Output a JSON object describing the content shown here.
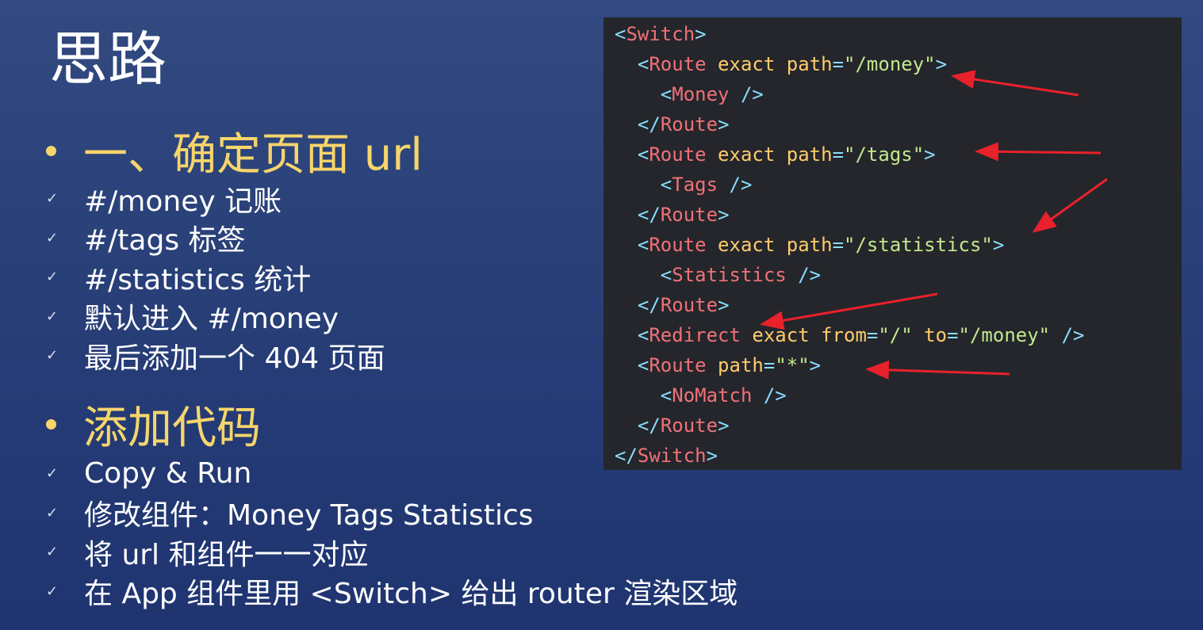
{
  "slide": {
    "title": "思路"
  },
  "sections": [
    {
      "heading": "一、确定页面 url",
      "items": [
        "#/money 记账",
        "#/tags 标签",
        "#/statistics 统计",
        "默认进入 #/money",
        "最后添加一个 404 页面"
      ]
    },
    {
      "heading": "添加代码",
      "items": [
        "Copy & Run",
        "修改组件：Money Tags Statistics",
        "将 url 和组件一一对应",
        "在 App 组件里用 <Switch> 给出 router 渲染区域"
      ]
    }
  ],
  "code": {
    "lines": [
      [
        {
          "t": "<",
          "c": "punct"
        },
        {
          "t": "Switch",
          "c": "tag"
        },
        {
          "t": ">",
          "c": "punct"
        }
      ],
      [
        {
          "t": "  "
        },
        {
          "t": "<",
          "c": "punct"
        },
        {
          "t": "Route",
          "c": "tag"
        },
        {
          "t": " exact path",
          "c": "attr"
        },
        {
          "t": "=",
          "c": "op"
        },
        {
          "t": "\"/money\"",
          "c": "str"
        },
        {
          "t": ">",
          "c": "punct"
        }
      ],
      [
        {
          "t": "    "
        },
        {
          "t": "<",
          "c": "punct"
        },
        {
          "t": "Money",
          "c": "tag"
        },
        {
          "t": " />",
          "c": "punct"
        }
      ],
      [
        {
          "t": "  "
        },
        {
          "t": "</",
          "c": "punct"
        },
        {
          "t": "Route",
          "c": "tag"
        },
        {
          "t": ">",
          "c": "punct"
        }
      ],
      [
        {
          "t": "  "
        },
        {
          "t": "<",
          "c": "punct"
        },
        {
          "t": "Route",
          "c": "tag"
        },
        {
          "t": " exact path",
          "c": "attr"
        },
        {
          "t": "=",
          "c": "op"
        },
        {
          "t": "\"/tags\"",
          "c": "str"
        },
        {
          "t": ">",
          "c": "punct"
        }
      ],
      [
        {
          "t": "    "
        },
        {
          "t": "<",
          "c": "punct"
        },
        {
          "t": "Tags",
          "c": "tag"
        },
        {
          "t": " />",
          "c": "punct"
        }
      ],
      [
        {
          "t": "  "
        },
        {
          "t": "</",
          "c": "punct"
        },
        {
          "t": "Route",
          "c": "tag"
        },
        {
          "t": ">",
          "c": "punct"
        }
      ],
      [
        {
          "t": "  "
        },
        {
          "t": "<",
          "c": "punct"
        },
        {
          "t": "Route",
          "c": "tag"
        },
        {
          "t": " exact path",
          "c": "attr"
        },
        {
          "t": "=",
          "c": "op"
        },
        {
          "t": "\"/statistics\"",
          "c": "str"
        },
        {
          "t": ">",
          "c": "punct"
        }
      ],
      [
        {
          "t": "    "
        },
        {
          "t": "<",
          "c": "punct"
        },
        {
          "t": "Statistics",
          "c": "tag"
        },
        {
          "t": " />",
          "c": "punct"
        }
      ],
      [
        {
          "t": "  "
        },
        {
          "t": "</",
          "c": "punct"
        },
        {
          "t": "Route",
          "c": "tag"
        },
        {
          "t": ">",
          "c": "punct"
        }
      ],
      [
        {
          "t": "  "
        },
        {
          "t": "<",
          "c": "punct"
        },
        {
          "t": "Redirect",
          "c": "tag"
        },
        {
          "t": " exact from",
          "c": "attr"
        },
        {
          "t": "=",
          "c": "op"
        },
        {
          "t": "\"/\"",
          "c": "str"
        },
        {
          "t": " to",
          "c": "attr"
        },
        {
          "t": "=",
          "c": "op"
        },
        {
          "t": "\"/money\"",
          "c": "str"
        },
        {
          "t": " />",
          "c": "punct"
        }
      ],
      [
        {
          "t": "  "
        },
        {
          "t": "<",
          "c": "punct"
        },
        {
          "t": "Route",
          "c": "tag"
        },
        {
          "t": " path",
          "c": "attr"
        },
        {
          "t": "=",
          "c": "op"
        },
        {
          "t": "\"*\"",
          "c": "str"
        },
        {
          "t": ">",
          "c": "punct"
        }
      ],
      [
        {
          "t": "    "
        },
        {
          "t": "<",
          "c": "punct"
        },
        {
          "t": "NoMatch",
          "c": "tag"
        },
        {
          "t": " />",
          "c": "punct"
        }
      ],
      [
        {
          "t": "  "
        },
        {
          "t": "</",
          "c": "punct"
        },
        {
          "t": "Route",
          "c": "tag"
        },
        {
          "t": ">",
          "c": "punct"
        }
      ],
      [
        {
          "t": "</",
          "c": "punct"
        },
        {
          "t": "Switch",
          "c": "tag"
        },
        {
          "t": ">",
          "c": "punct"
        }
      ]
    ]
  },
  "colors": {
    "background_top": "#324a80",
    "background_bottom": "#1f3470",
    "heading": "#f6d56b",
    "code_background": "#24262b",
    "code_tag": "#f07178",
    "code_punct": "#89ddff",
    "code_attr": "#ffcb6b",
    "code_string": "#c3e88d",
    "annotation_arrow": "#e8212b"
  },
  "icons": {
    "bullet": "round-bullet-icon",
    "check": "checkmark-icon",
    "annotation": "red-arrow-icon"
  }
}
